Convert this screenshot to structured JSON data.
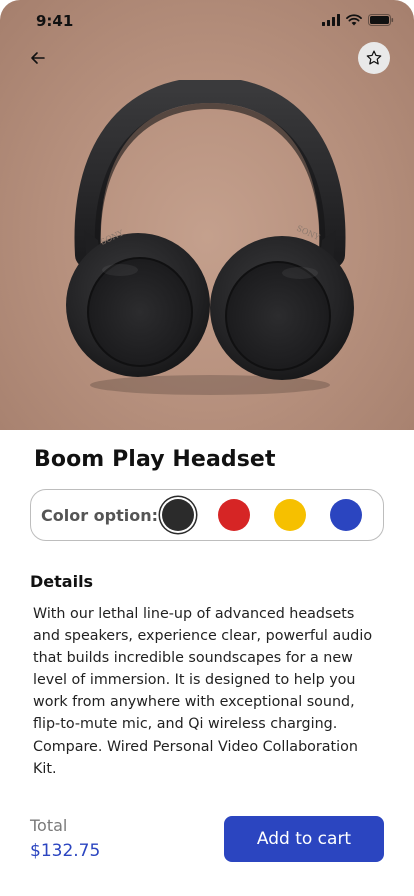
{
  "status_bar": {
    "time": "9:41"
  },
  "product": {
    "title": "Boom Play Headset",
    "brand_marking": "SONY",
    "image_icon": "headphones-image"
  },
  "color_options": {
    "label": "Color option:",
    "swatches": [
      {
        "name": "black",
        "color": "#2b2b2b",
        "selected": true
      },
      {
        "name": "red",
        "color": "#d62525",
        "selected": false
      },
      {
        "name": "yellow",
        "color": "#f6c000",
        "selected": false
      },
      {
        "name": "blue",
        "color": "#2b45c0",
        "selected": false
      }
    ]
  },
  "details": {
    "title": "Details",
    "text": "With our lethal line-up of advanced headsets and speakers, experience clear, powerful audio that builds incredible soundscapes for a new level of immersion. It is designed to help you work from anywhere with exceptional sound, flip-to-mute mic, and Qi wireless charging. Compare. Wired Personal Video Collaboration Kit."
  },
  "footer": {
    "total_label": "Total",
    "total_price": "$132.75",
    "add_to_cart_label": "Add to cart"
  },
  "icons": {
    "back": "arrow-left-icon",
    "favorite": "star-icon",
    "signal": "signal-icon",
    "wifi": "wifi-icon",
    "battery": "battery-icon"
  },
  "colors": {
    "accent": "#2b45c0",
    "hero_background": "#b8927f"
  }
}
